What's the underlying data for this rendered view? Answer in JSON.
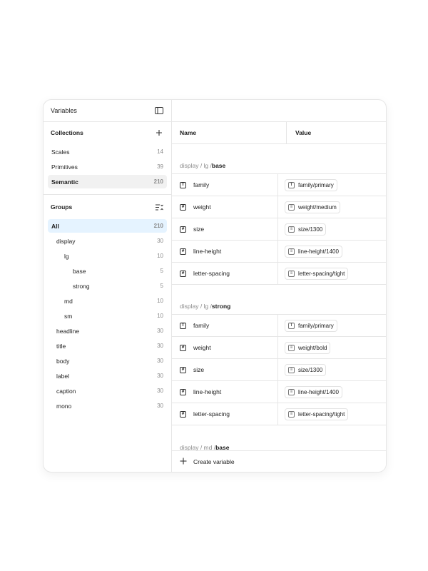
{
  "sidebar": {
    "title": "Variables",
    "collections_label": "Collections",
    "collections": [
      {
        "label": "Scales",
        "count": "14"
      },
      {
        "label": "Primitives",
        "count": "39"
      },
      {
        "label": "Semantic",
        "count": "210"
      }
    ],
    "groups_label": "Groups",
    "groups": [
      {
        "label": "All",
        "count": "210"
      },
      {
        "label": "display",
        "count": "30"
      },
      {
        "label": "lg",
        "count": "10"
      },
      {
        "label": "base",
        "count": "5"
      },
      {
        "label": "strong",
        "count": "5"
      },
      {
        "label": "md",
        "count": "10"
      },
      {
        "label": "sm",
        "count": "10"
      },
      {
        "label": "headline",
        "count": "30"
      },
      {
        "label": "title",
        "count": "30"
      },
      {
        "label": "body",
        "count": "30"
      },
      {
        "label": "label",
        "count": "30"
      },
      {
        "label": "caption",
        "count": "30"
      },
      {
        "label": "mono",
        "count": "30"
      }
    ]
  },
  "table": {
    "col_name": "Name",
    "col_value": "Value",
    "sections": [
      {
        "path": "display / lg / ",
        "leaf": "base",
        "rows": [
          {
            "icon": "T",
            "name": "family",
            "value_icon": "T",
            "value": "family/primary"
          },
          {
            "icon": "#",
            "name": "weight",
            "value_icon": "≡",
            "value": "weight/medium"
          },
          {
            "icon": "#",
            "name": "size",
            "value_icon": "≡",
            "value": "size/1300"
          },
          {
            "icon": "#",
            "name": "line-height",
            "value_icon": "≡",
            "value": "line-height/1400"
          },
          {
            "icon": "#",
            "name": "letter-spacing",
            "value_icon": "≡",
            "value": "letter-spacing/tight"
          }
        ]
      },
      {
        "path": "display / lg / ",
        "leaf": "strong",
        "rows": [
          {
            "icon": "T",
            "name": "family",
            "value_icon": "T",
            "value": "family/primary"
          },
          {
            "icon": "#",
            "name": "weight",
            "value_icon": "≡",
            "value": "weight/bold"
          },
          {
            "icon": "#",
            "name": "size",
            "value_icon": "≡",
            "value": "size/1300"
          },
          {
            "icon": "#",
            "name": "line-height",
            "value_icon": "≡",
            "value": "line-height/1400"
          },
          {
            "icon": "#",
            "name": "letter-spacing",
            "value_icon": "≡",
            "value": "letter-spacing/tight"
          }
        ]
      },
      {
        "path": "display / md / ",
        "leaf": "base",
        "rows": []
      }
    ]
  },
  "footer": {
    "create_label": "Create variable"
  },
  "colors": {
    "selected_bg": "#f1f1f1",
    "active_bg": "#e5f3ff",
    "border": "#e6e6e6"
  }
}
